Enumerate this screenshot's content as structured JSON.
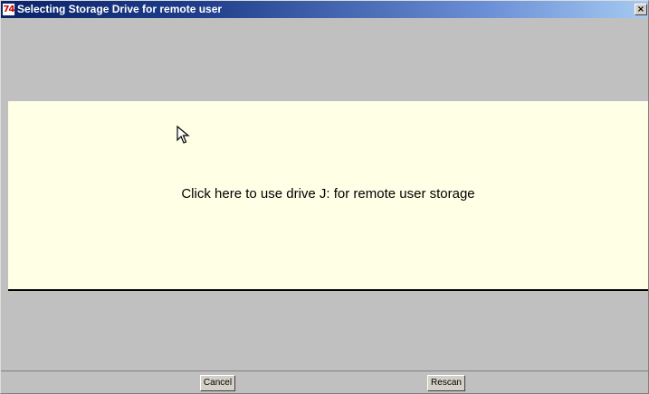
{
  "window": {
    "title": "Selecting Storage Drive for remote user",
    "app_icon": "74",
    "close_glyph": "×"
  },
  "content": {
    "message": "Click here to use drive J: for remote user storage"
  },
  "buttons": {
    "cancel_label": "Cancel",
    "rescan_label": "Rescan"
  },
  "icons": {
    "app": "app-logo-icon",
    "close": "close-icon",
    "cursor": "mouse-pointer-icon"
  },
  "colors": {
    "titlebar_start": "#0a246a",
    "titlebar_end": "#a6caf0",
    "panel_gray": "#c0c0c0",
    "content_bg": "#ffffe6",
    "app_icon_red": "#d40000"
  }
}
